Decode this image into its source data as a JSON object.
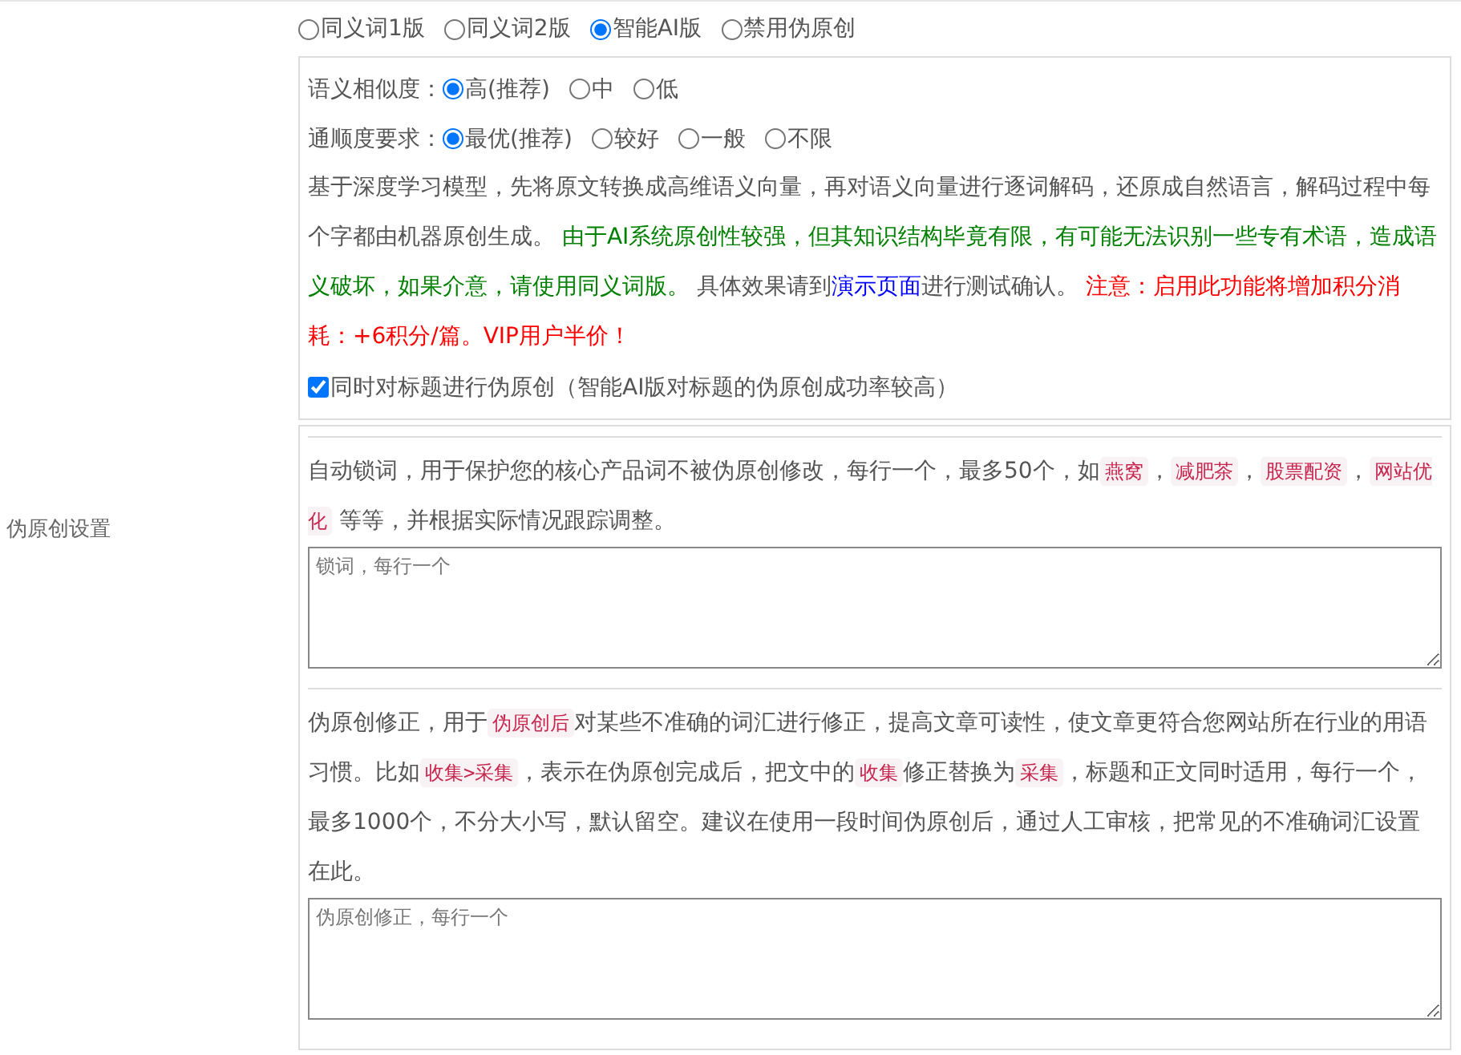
{
  "section_label": "伪原创设置",
  "mode_options": [
    {
      "label": "同义词1版",
      "selected": false
    },
    {
      "label": "同义词2版",
      "selected": false
    },
    {
      "label": "智能AI版",
      "selected": true
    },
    {
      "label": "禁用伪原创",
      "selected": false
    }
  ],
  "ai_panel": {
    "settings": [
      {
        "label": "语义相似度：",
        "options": [
          {
            "label": "高(推荐)",
            "selected": true
          },
          {
            "label": "中",
            "selected": false
          },
          {
            "label": "低",
            "selected": false
          }
        ]
      },
      {
        "label": "通顺度要求：",
        "options": [
          {
            "label": "最优(推荐)",
            "selected": true
          },
          {
            "label": "较好",
            "selected": false
          },
          {
            "label": "一般",
            "selected": false
          },
          {
            "label": "不限",
            "selected": false
          }
        ]
      }
    ],
    "description": [
      {
        "kind": "plain",
        "text": "基于深度学习模型，先将原文转换成高维语义向量，再对语义向量进行逐词解码，还原成自然语言，解码过程中每个字都由机器原创生成。 "
      },
      {
        "kind": "caution",
        "text": "由于AI系统原创性较强，但其知识结构毕竟有限，有可能无法识别一些专有术语，造成语义破坏，如果介意，请使用同义词版。"
      },
      {
        "kind": "plain",
        "text": " 具体效果请到"
      },
      {
        "kind": "link",
        "text": "演示页面"
      },
      {
        "kind": "plain",
        "text": "进行测试确认。 "
      },
      {
        "kind": "alert",
        "text": "注意：启用此功能将增加积分消耗：+6积分/篇。VIP用户半价！"
      }
    ],
    "checkbox": {
      "label": "同时对标题进行伪原创（智能AI版对标题的伪原创成功率较高）",
      "checked": true
    }
  },
  "lock_words": {
    "description": [
      {
        "kind": "plain",
        "text": "自动锁词，用于保护您的核心产品词不被伪原创修改，每行一个，最多50个，如"
      },
      {
        "kind": "code",
        "text": "燕窝"
      },
      {
        "kind": "plain",
        "text": "，"
      },
      {
        "kind": "code",
        "text": "减肥茶"
      },
      {
        "kind": "plain",
        "text": "，"
      },
      {
        "kind": "code",
        "text": "股票配资"
      },
      {
        "kind": "plain",
        "text": "，"
      },
      {
        "kind": "code",
        "text": "网站优化"
      },
      {
        "kind": "plain",
        "text": " 等等，并根据实际情况跟踪调整。"
      }
    ],
    "placeholder": "锁词，每行一个"
  },
  "correction": {
    "description": [
      {
        "kind": "plain",
        "text": "伪原创修正，用于"
      },
      {
        "kind": "code",
        "text": "伪原创后"
      },
      {
        "kind": "plain",
        "text": "对某些不准确的词汇进行修正，提高文章可读性，使文章更符合您网站所在行业的用语习惯。比如"
      },
      {
        "kind": "code",
        "text": "收集>采集"
      },
      {
        "kind": "plain",
        "text": "，表示在伪原创完成后，把文中的"
      },
      {
        "kind": "code",
        "text": "收集"
      },
      {
        "kind": "plain",
        "text": "修正替换为"
      },
      {
        "kind": "code",
        "text": "采集"
      },
      {
        "kind": "plain",
        "text": "，标题和正文同时适用，每行一个，最多1000个，不分大小写，默认留空。建议在使用一段时间伪原创后，通过人工审核，把常见的不准确词汇设置在此。"
      }
    ],
    "placeholder": "伪原创修正，每行一个"
  }
}
